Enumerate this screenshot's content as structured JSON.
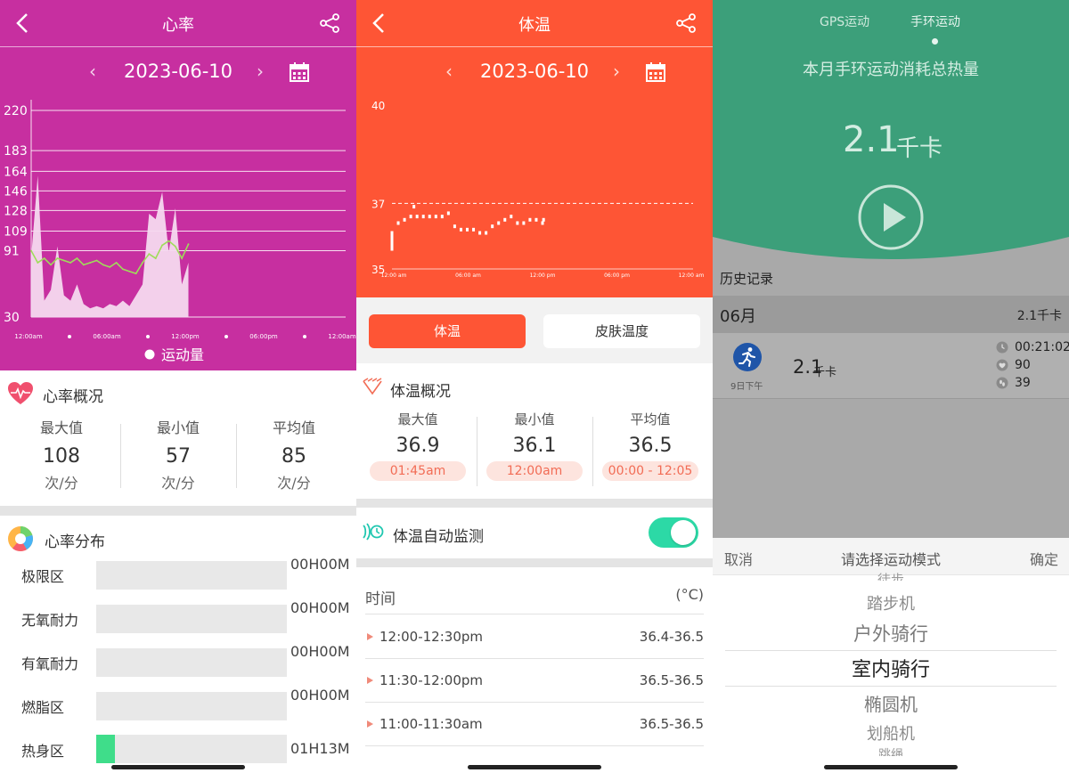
{
  "heart": {
    "title": "心率",
    "date": "2023-06-10",
    "prev": "‹",
    "next": "›",
    "y_ticks": [
      "220",
      "183",
      "164",
      "146",
      "128",
      "109",
      "91",
      "30"
    ],
    "x_ticks": [
      "12:00am",
      "06:00am",
      "12:00pm",
      "06:00pm",
      "12:00am"
    ],
    "legend": "运动量",
    "overview_title": "心率概况",
    "stats": [
      {
        "label": "最大值",
        "value": "108",
        "unit": "次/分"
      },
      {
        "label": "最小值",
        "value": "57",
        "unit": "次/分"
      },
      {
        "label": "平均值",
        "value": "85",
        "unit": "次/分"
      }
    ],
    "dist_title": "心率分布",
    "zones": [
      {
        "label": "极限区",
        "value": "00H00M",
        "fill": 0
      },
      {
        "label": "无氧耐力",
        "value": "00H00M",
        "fill": 0
      },
      {
        "label": "有氧耐力",
        "value": "00H00M",
        "fill": 0
      },
      {
        "label": "燃脂区",
        "value": "00H00M",
        "fill": 0
      },
      {
        "label": "热身区",
        "value": "01H13M",
        "fill": 0.1
      }
    ],
    "colors": {
      "bg": "#c72fa0",
      "line": "#9fdc5a",
      "area": "#f6d9ef",
      "zone": "#3fdd8a"
    }
  },
  "temp": {
    "title": "体温",
    "date": "2023-06-10",
    "prev": "‹",
    "next": "›",
    "y_ticks": [
      "40",
      "37",
      "35"
    ],
    "x_ticks": [
      "12:00 am",
      "06:00 am",
      "12:00 pm",
      "06:00 pm",
      "12:00 am"
    ],
    "tabs": [
      {
        "label": "体温",
        "active": true
      },
      {
        "label": "皮肤温度",
        "active": false
      }
    ],
    "overview_title": "体温概况",
    "stats": [
      {
        "label": "最大值",
        "value": "36.9",
        "time": "01:45am"
      },
      {
        "label": "最小值",
        "value": "36.1",
        "time": "12:00am"
      },
      {
        "label": "平均值",
        "value": "36.5",
        "time": "00:00 - 12:05"
      }
    ],
    "auto_label": "体温自动监测",
    "auto_on": true,
    "table_header": {
      "time": "时间",
      "unit": "(°C)"
    },
    "rows": [
      {
        "time": "12:00-12:30pm",
        "value": "36.4-36.5"
      },
      {
        "time": "11:30-12:00pm",
        "value": "36.5-36.5"
      },
      {
        "time": "11:00-11:30am",
        "value": "36.5-36.5"
      }
    ],
    "colors": {
      "bg": "#fe5535",
      "tab_active": "#fe5535",
      "toggle": "#2cd9a6"
    }
  },
  "sport": {
    "tabs": [
      "GPS运动",
      "手环运动"
    ],
    "subtitle": "本月手环运动消耗总热量",
    "calories_value": "2.1",
    "calories_unit": "千卡",
    "history_label": "历史记录",
    "month": "06月",
    "month_total": "2.1千卡",
    "record": {
      "value": "2.1",
      "unit": "千卡",
      "day": "9日下午",
      "duration": "00:21:02",
      "heart": "90",
      "steps": "39"
    },
    "picker": {
      "cancel": "取消",
      "title": "请选择运动模式",
      "confirm": "确定",
      "items": [
        "徒步",
        "踏步机",
        "户外骑行",
        "室内骑行",
        "椭圆机",
        "划船机",
        "跳绳"
      ],
      "selected": "室内骑行"
    },
    "colors": {
      "green": "#3c9f7a",
      "overlay": "#a9a9a9"
    }
  },
  "chart_data": [
    {
      "type": "line",
      "title": "",
      "xlabel": "",
      "ylabel": "",
      "x_range": [
        "12:00am",
        "12:00am"
      ],
      "ylim": [
        30,
        220
      ],
      "grid": true,
      "series": [
        {
          "name": "",
          "x": [
            "00:00",
            "00:30",
            "01:00",
            "01:30",
            "02:00",
            "02:30",
            "03:00",
            "03:30",
            "04:00",
            "04:30",
            "05:00",
            "05:30",
            "06:00",
            "06:30",
            "07:00",
            "07:30",
            "08:00",
            "08:30",
            "09:00",
            "09:30",
            "10:00",
            "10:30",
            "11:00",
            "11:30",
            "12:00"
          ],
          "values": [
            91,
            80,
            84,
            78,
            84,
            82,
            80,
            84,
            78,
            80,
            82,
            78,
            76,
            80,
            74,
            72,
            70,
            80,
            88,
            84,
            96,
            100,
            95,
            84,
            97
          ]
        }
      ],
      "area_values": [
        85,
        160,
        45,
        55,
        95,
        50,
        45,
        60,
        42,
        38,
        40,
        38,
        42,
        40,
        45,
        40,
        50,
        60,
        125,
        120,
        145,
        90,
        130,
        60,
        80
      ],
      "legend_placement": "bottom"
    },
    {
      "type": "scatter",
      "title": "",
      "xlabel": "",
      "ylabel": "",
      "ylim": [
        35,
        40
      ],
      "reference_line": 37,
      "x": [
        "00:00",
        "00:30",
        "01:00",
        "01:30",
        "01:45",
        "02:00",
        "02:30",
        "03:00",
        "03:30",
        "04:00",
        "04:30",
        "05:00",
        "05:30",
        "06:00",
        "06:30",
        "07:00",
        "07:30",
        "08:00",
        "08:30",
        "09:00",
        "09:30",
        "10:00",
        "10:30",
        "11:00",
        "11:30",
        "12:00",
        "12:05"
      ],
      "values": [
        36.1,
        36.4,
        36.5,
        36.6,
        36.9,
        36.6,
        36.6,
        36.6,
        36.6,
        36.6,
        36.7,
        36.3,
        36.2,
        36.2,
        36.2,
        36.1,
        36.1,
        36.3,
        36.4,
        36.5,
        36.6,
        36.4,
        36.4,
        36.5,
        36.5,
        36.4,
        36.5
      ]
    }
  ]
}
